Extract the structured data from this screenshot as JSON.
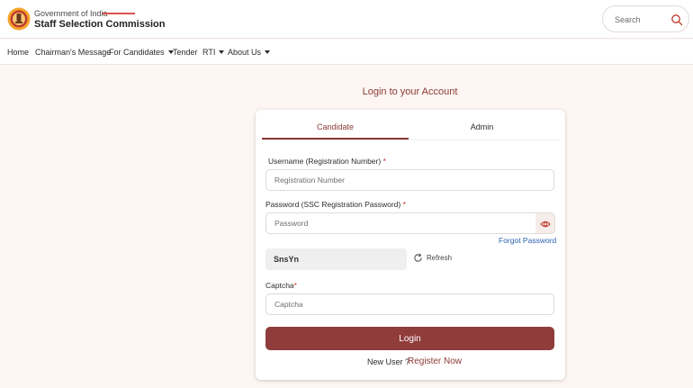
{
  "header": {
    "gov_text": "Government of India",
    "org_name": "Staff Selection Commission",
    "search_label": "Search",
    "logo_icon": "national-emblem-icon",
    "search_icon": "search-icon"
  },
  "nav": {
    "items": [
      {
        "label": "Home",
        "dropdown": false
      },
      {
        "label": "Chairman's Message",
        "dropdown": false
      },
      {
        "label": "For Candidates",
        "dropdown": true
      },
      {
        "label": "Tender",
        "dropdown": false
      },
      {
        "label": "RTI",
        "dropdown": true
      },
      {
        "label": "About Us",
        "dropdown": true
      }
    ]
  },
  "login": {
    "heading": "Login to your Account",
    "tabs": [
      {
        "label": "Candidate",
        "active": true
      },
      {
        "label": "Admin",
        "active": false
      }
    ],
    "username": {
      "label": "Username (Registration Number)",
      "placeholder": "Registration Number",
      "value": ""
    },
    "password": {
      "label": "Password (SSC Registration Password)",
      "placeholder": "Password",
      "value": ""
    },
    "required_mark": "*",
    "forgot_password": "Forgot Password",
    "captcha_code": "SnsYn",
    "refresh_label": "Refresh",
    "captcha": {
      "label": "Captcha",
      "placeholder": "Captcha",
      "value": ""
    },
    "login_button": "Login",
    "new_user_text": "New User ?",
    "register_link": "Register Now"
  },
  "colors": {
    "accent": "#8b3a36",
    "button": "#8f3c3b",
    "link": "#2a64b0",
    "background": "#fdf6f3"
  }
}
